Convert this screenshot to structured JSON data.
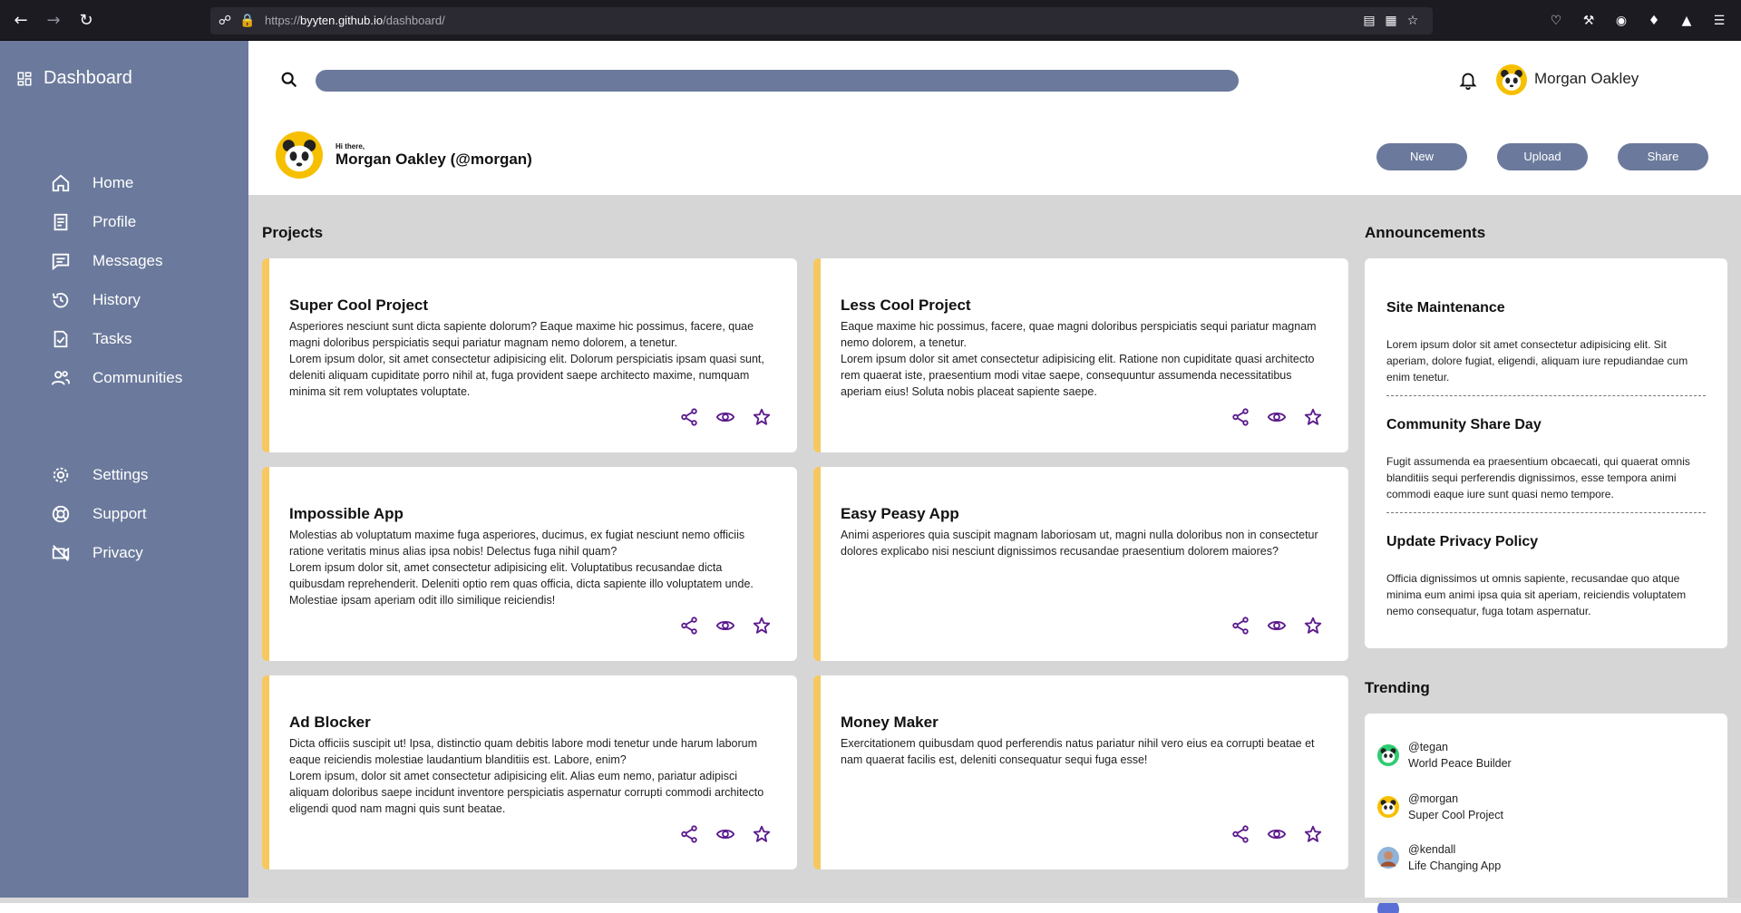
{
  "browser": {
    "url_prefix": "https://",
    "url_host": "byyten.github.io",
    "url_path": "/dashboard/"
  },
  "sidebar": {
    "brand": "Dashboard",
    "items": [
      {
        "label": "Home",
        "icon": "home-icon"
      },
      {
        "label": "Profile",
        "icon": "profile-icon"
      },
      {
        "label": "Messages",
        "icon": "messages-icon"
      },
      {
        "label": "History",
        "icon": "history-icon"
      },
      {
        "label": "Tasks",
        "icon": "tasks-icon"
      },
      {
        "label": "Communities",
        "icon": "communities-icon"
      },
      {
        "label": "Settings",
        "icon": "gear-icon"
      },
      {
        "label": "Support",
        "icon": "support-icon"
      },
      {
        "label": "Privacy",
        "icon": "privacy-icon"
      }
    ]
  },
  "header": {
    "search_placeholder": "",
    "user_name": "Morgan Oakley",
    "greeting_small": "Hi there,",
    "greeting_name": "Morgan Oakley (@morgan)",
    "buttons": {
      "new": "New",
      "upload": "Upload",
      "share": "Share"
    }
  },
  "projects": {
    "title": "Projects",
    "cards": [
      {
        "title": "Super Cool Project",
        "para1": "Asperiores nesciunt sunt dicta sapiente dolorum? Eaque maxime hic possimus, facere, quae magni doloribus perspiciatis sequi pariatur magnam nemo dolorem, a tenetur.",
        "para2": "Lorem ipsum dolor, sit amet consectetur adipisicing elit. Dolorum perspiciatis ipsam quasi sunt, deleniti aliquam cupiditate porro nihil at, fuga provident saepe architecto maxime, numquam minima sit rem voluptates voluptate."
      },
      {
        "title": "Less Cool Project",
        "para1": "Eaque maxime hic possimus, facere, quae magni doloribus perspiciatis sequi pariatur magnam nemo dolorem, a tenetur.",
        "para2": "Lorem ipsum dolor sit amet consectetur adipisicing elit. Ratione non cupiditate quasi architecto rem quaerat iste, praesentium modi vitae saepe, consequuntur assumenda necessitatibus aperiam eius! Soluta nobis placeat sapiente saepe."
      },
      {
        "title": "Impossible App",
        "para1": "Molestias ab voluptatum maxime fuga asperiores, ducimus, ex fugiat nesciunt nemo officiis ratione veritatis minus alias ipsa nobis! Delectus fuga nihil quam?",
        "para2": "Lorem ipsum dolor sit, amet consectetur adipisicing elit. Voluptatibus recusandae dicta quibusdam reprehenderit. Deleniti optio rem quas officia, dicta sapiente illo voluptatem unde. Molestiae ipsam aperiam odit illo similique reiciendis!"
      },
      {
        "title": "Easy Peasy App",
        "para1": "Animi asperiores quia suscipit magnam laboriosam ut, magni nulla doloribus non in consectetur dolores explicabo nisi nesciunt dignissimos recusandae praesentium dolorem maiores?",
        "para2": ""
      },
      {
        "title": "Ad Blocker",
        "para1": "Dicta officiis suscipit ut! Ipsa, distinctio quam debitis labore modi tenetur unde harum laborum eaque reiciendis molestiae laudantium blanditiis est. Labore, enim?",
        "para2": "Lorem ipsum, dolor sit amet consectetur adipisicing elit. Alias eum nemo, pariatur adipisci aliquam doloribus saepe incidunt inventore perspiciatis aspernatur corrupti commodi architecto eligendi quod nam magni quis sunt beatae."
      },
      {
        "title": "Money Maker",
        "para1": "Exercitationem quibusdam quod perferendis natus pariatur nihil vero eius ea corrupti beatae et nam quaerat facilis est, deleniti consequatur sequi fuga esse!",
        "para2": ""
      }
    ]
  },
  "announcements": {
    "title": "Announcements",
    "items": [
      {
        "title": "Site Maintenance",
        "text": "Lorem ipsum dolor sit amet consectetur adipisicing elit. Sit aperiam, dolore fugiat, eligendi, aliquam iure repudiandae cum enim tenetur."
      },
      {
        "title": "Community Share Day",
        "text": "Fugit assumenda ea praesentium obcaecati, qui quaerat omnis blanditiis sequi perferendis dignissimos, esse tempora animi commodi eaque iure sunt quasi nemo tempore."
      },
      {
        "title": "Update Privacy Policy",
        "text": "Officia dignissimos ut omnis sapiente, recusandae quo atque minima eum animi ipsa quia sit aperiam, reiciendis voluptatem nemo consequatur, fuga totam aspernatur."
      }
    ]
  },
  "trending": {
    "title": "Trending",
    "items": [
      {
        "handle": "@tegan",
        "project": "World Peace Builder"
      },
      {
        "handle": "@morgan",
        "project": "Super Cool Project"
      },
      {
        "handle": "@kendall",
        "project": "Life Changing App"
      }
    ]
  },
  "colors": {
    "sidebar": "#6b7a9c",
    "accent": "#f6c85f",
    "action_icons": "#5b1a8c",
    "main_bg": "#d6d6d6"
  }
}
